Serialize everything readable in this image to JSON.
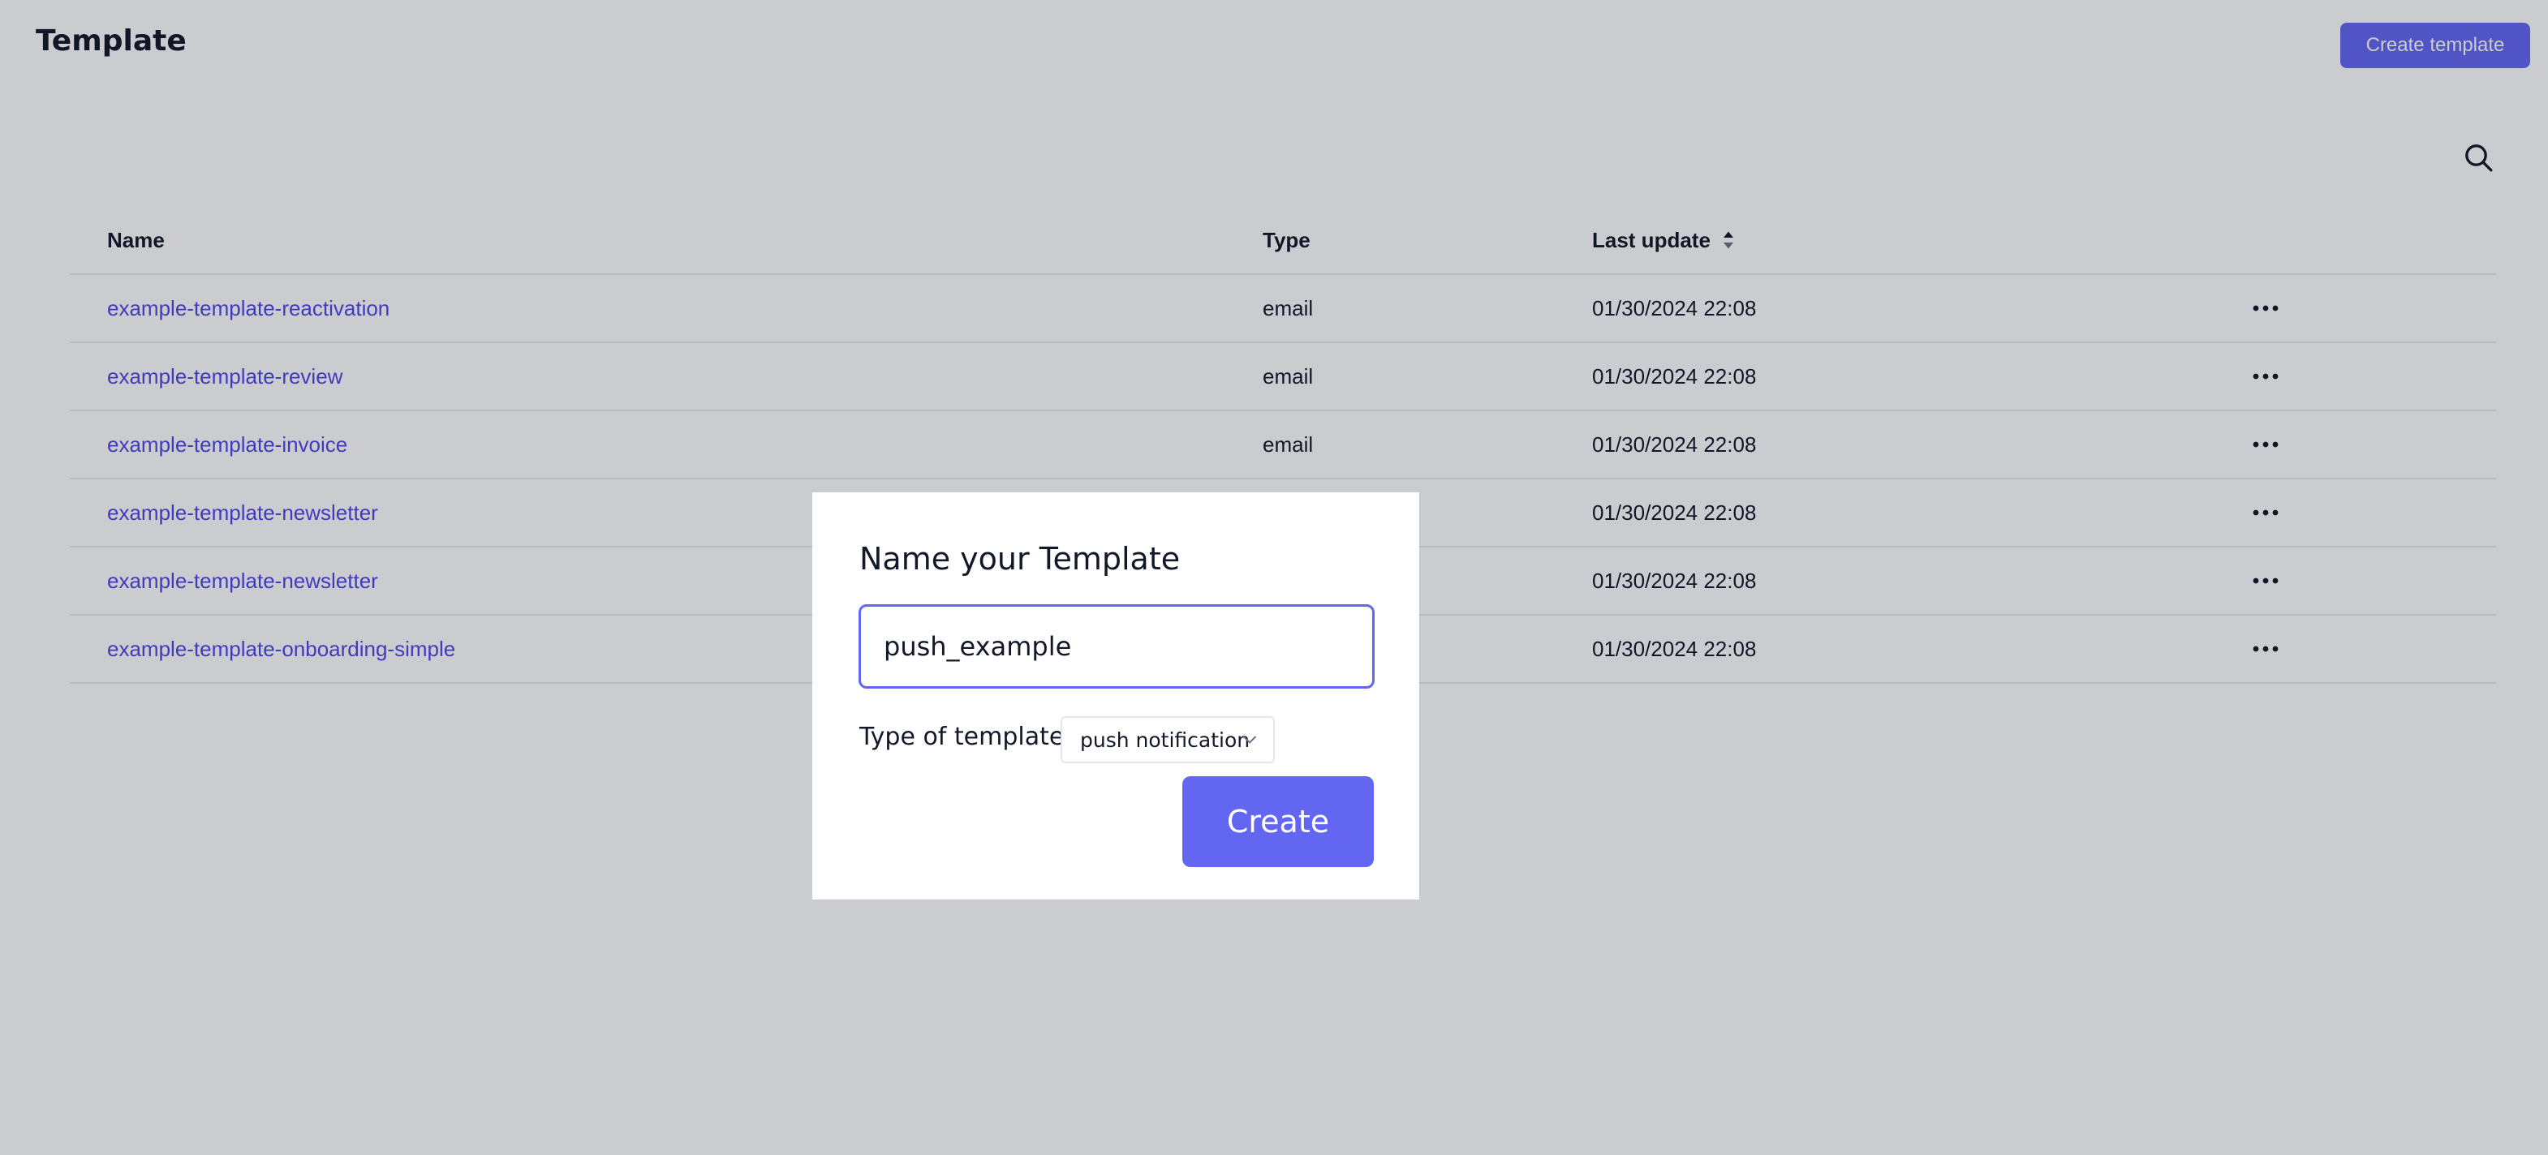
{
  "page": {
    "title": "Template",
    "create_button_label": "Create template"
  },
  "table": {
    "columns": {
      "name": "Name",
      "type": "Type",
      "last_update": "Last update"
    },
    "rows": [
      {
        "name": "example-template-reactivation",
        "type": "email",
        "last_update": "01/30/2024 22:08"
      },
      {
        "name": "example-template-review",
        "type": "email",
        "last_update": "01/30/2024 22:08"
      },
      {
        "name": "example-template-invoice",
        "type": "email",
        "last_update": "01/30/2024 22:08"
      },
      {
        "name": "example-template-newsletter",
        "type": "",
        "last_update": "01/30/2024 22:08"
      },
      {
        "name": "example-template-newsletter",
        "type": "",
        "last_update": "01/30/2024 22:08"
      },
      {
        "name": "example-template-onboarding-simple",
        "type": "",
        "last_update": "01/30/2024 22:08"
      }
    ]
  },
  "modal": {
    "title": "Name your Template",
    "name_input_value": "push_example",
    "type_label": "Type of template:",
    "type_selected": "push notification",
    "create_button_label": "Create"
  },
  "icons": {
    "search": "search-icon",
    "sort": "sort-icon",
    "more": "more-horizontal-icon",
    "chevron": "chevron-down-icon"
  },
  "colors": {
    "accent": "#6366f1",
    "link": "#4f46e5",
    "overlay": "rgba(17,24,39,0.22)"
  }
}
